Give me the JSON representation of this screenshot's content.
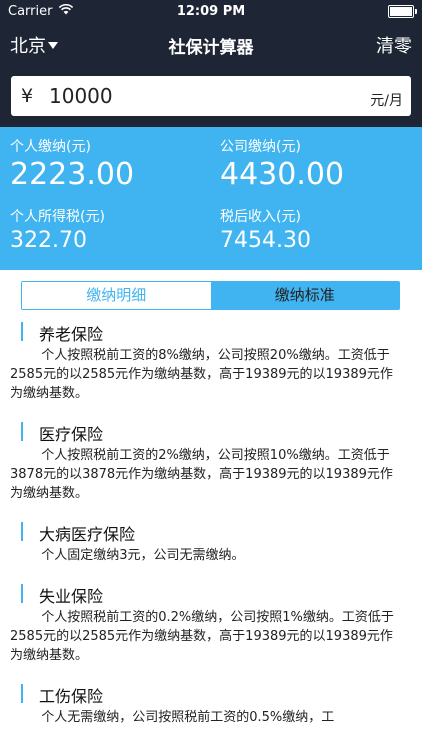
{
  "status_bar": {
    "carrier": "Carrier",
    "time": "12:09 PM"
  },
  "nav": {
    "city": "北京",
    "title": "社保计算器",
    "clear_label": "清零"
  },
  "salary_input": {
    "currency": "¥",
    "value": "10000",
    "unit": "元/月"
  },
  "results": {
    "personal_payment": {
      "label": "个人缴纳(元)",
      "value": "2223.00"
    },
    "company_payment": {
      "label": "公司缴纳(元)",
      "value": "4430.00"
    },
    "income_tax": {
      "label": "个人所得税(元)",
      "value": "322.70"
    },
    "after_tax_income": {
      "label": "税后收入(元)",
      "value": "7454.30"
    }
  },
  "tabs": [
    {
      "label": "缴纳明细",
      "active": false
    },
    {
      "label": "缴纳标准",
      "active": true
    }
  ],
  "sections": [
    {
      "title": "养老保险",
      "text": "个人按照税前工资的8%缴纳，公司按照20%缴纳。工资低于2585元的以2585元作为缴纳基数，高于19389元的以19389元作为缴纳基数。"
    },
    {
      "title": "医疗保险",
      "text": "个人按照税前工资的2%缴纳，公司按照10%缴纳。工资低于3878元的以3878元作为缴纳基数，高于19389元的以19389元作为缴纳基数。"
    },
    {
      "title": "大病医疗保险",
      "text": "个人固定缴纳3元，公司无需缴纳。"
    },
    {
      "title": "失业保险",
      "text": "个人按照税前工资的0.2%缴纳，公司按照1%缴纳。工资低于2585元的以2585元作为缴纳基数，高于19389元的以19389元作为缴纳基数。"
    },
    {
      "title": "工伤保险",
      "text": "个人无需缴纳，公司按照税前工资的0.5%缴纳，工"
    }
  ],
  "colors": {
    "header_bg": "#1e2535",
    "accent": "#3fb4f0"
  },
  "icons": {
    "wifi": "wifi-icon",
    "battery": "battery-icon",
    "dropdown": "caret-down-icon"
  }
}
